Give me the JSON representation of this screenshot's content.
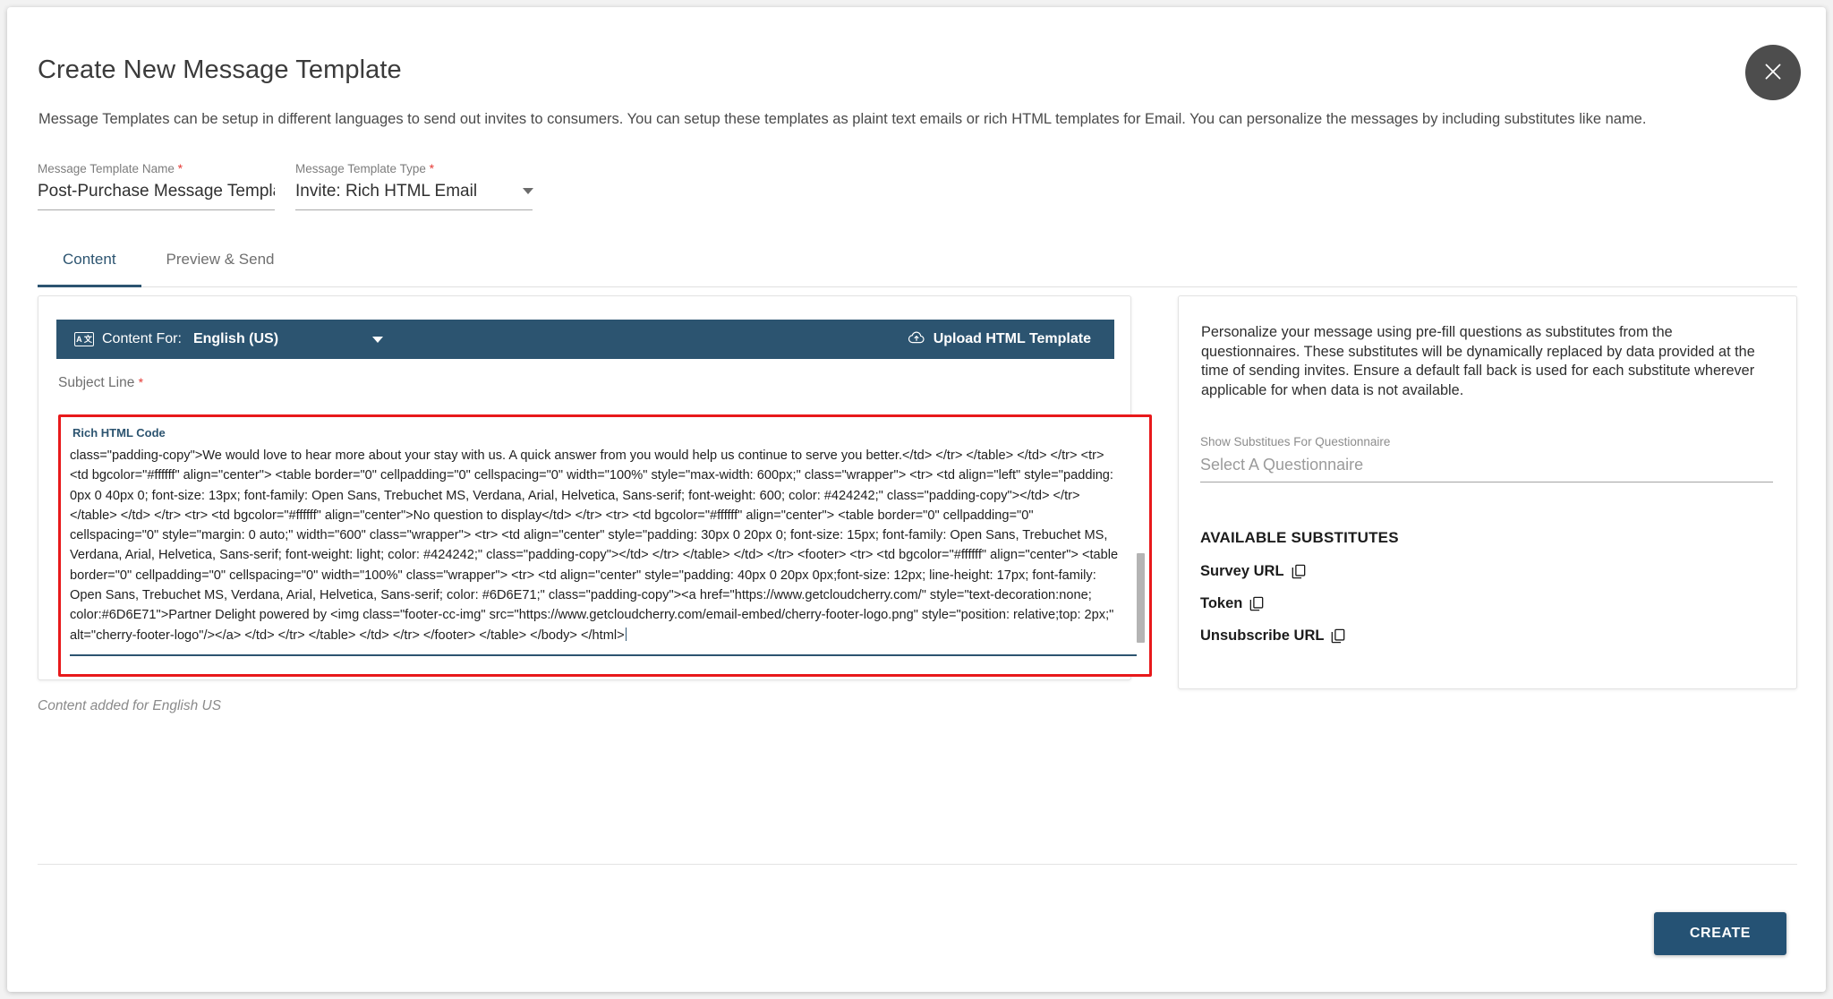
{
  "dialog": {
    "title": "Create New Message Template",
    "description": "Message Templates can be setup in different languages to send out invites to consumers. You can setup these templates as plaint text emails or rich HTML templates for Email. You can personalize the messages by including substitutes like name.",
    "close_icon": "close-icon"
  },
  "form": {
    "template_name": {
      "label": "Message Template Name",
      "required_marker": "*",
      "value": "Post-Purchase Message Template"
    },
    "template_type": {
      "label": "Message Template Type",
      "required_marker": "*",
      "value": "Invite: Rich HTML Email",
      "options": [
        "Invite: Rich HTML Email"
      ]
    }
  },
  "tabs": [
    {
      "label": "Content",
      "active": true
    },
    {
      "label": "Preview & Send",
      "active": false
    }
  ],
  "content_panel": {
    "content_for_label": "Content For:",
    "content_for_value": "English (US)",
    "language_icon": "language-icon",
    "upload_button": "Upload HTML Template",
    "upload_icon": "cloud-upload-icon",
    "subject_label": "Subject Line",
    "subject_required": "*",
    "subject_value": "",
    "code_legend": "Rich HTML Code",
    "code_value": "class=\"padding-copy\">We would love to hear more about your stay with us. A quick answer from you would help us continue to serve you better.</td> </tr> </table> </td> </tr> <tr> <td bgcolor=\"#ffffff\" align=\"center\"> <table border=\"0\" cellpadding=\"0\" cellspacing=\"0\" width=\"100%\" style=\"max-width: 600px;\" class=\"wrapper\"> <tr> <td align=\"left\" style=\"padding: 0px 0 40px 0; font-size: 13px; font-family: Open Sans, Trebuchet MS, Verdana, Arial, Helvetica, Sans-serif; font-weight: 600; color: #424242;\" class=\"padding-copy\"></td> </tr> </table> </td> </tr> <tr> <td bgcolor=\"#ffffff\" align=\"center\">No question to display</td> </tr> <tr> <td bgcolor=\"#ffffff\" align=\"center\"> <table border=\"0\" cellpadding=\"0\" cellspacing=\"0\" style=\"margin: 0 auto;\" width=\"600\" class=\"wrapper\"> <tr> <td align=\"center\" style=\"padding: 30px 0 20px 0; font-size: 15px; font-family: Open Sans, Trebuchet MS, Verdana, Arial, Helvetica, Sans-serif; font-weight: light; color: #424242;\" class=\"padding-copy\"></td> </tr> </table> </td> </tr> <footer> <tr> <td bgcolor=\"#ffffff\" align=\"center\"> <table border=\"0\" cellpadding=\"0\" cellspacing=\"0\" width=\"100%\" class=\"wrapper\"> <tr> <td align=\"center\" style=\"padding: 40px 0 20px 0px;font-size: 12px; line-height: 17px; font-family: Open Sans, Trebuchet MS, Verdana, Arial, Helvetica, Sans-serif; color: #6D6E71;\" class=\"padding-copy\"><a href=\"https://www.getcloudcherry.com/\" style=\"text-decoration:none; color:#6D6E71\">Partner Delight powered by <img class=\"footer-cc-img\" src=\"https://www.getcloudcherry.com/email-embed/cherry-footer-logo.png\" style=\"position: relative;top: 2px;\" alt=\"cherry-footer-logo\"/></a> </td> </tr> </table> </td> </tr> </footer> </table> </body> </html>",
    "status_text": "Content added for English US"
  },
  "side_panel": {
    "description": "Personalize your message using pre-fill questions as substitutes from the questionnaires. These substitutes will be dynamically replaced by data provided at the time of sending invites. Ensure a default fall back is used for each substitute wherever applicable for when data is not available.",
    "questionnaire_label": "Show Substitues For Questionnaire",
    "questionnaire_placeholder": "Select A Questionnaire",
    "questionnaire_value": "",
    "substitutes_title": "AVAILABLE SUBSTITUTES",
    "substitutes": [
      {
        "label": "Survey URL",
        "copy_icon": "copy-icon"
      },
      {
        "label": "Token",
        "copy_icon": "copy-icon"
      },
      {
        "label": "Unsubscribe URL",
        "copy_icon": "copy-icon"
      }
    ]
  },
  "footer": {
    "create_label": "CREATE"
  },
  "colors": {
    "accent": "#2c5470",
    "primary_button": "#255274",
    "error_border": "#e8191b",
    "required_star": "#e53935"
  }
}
